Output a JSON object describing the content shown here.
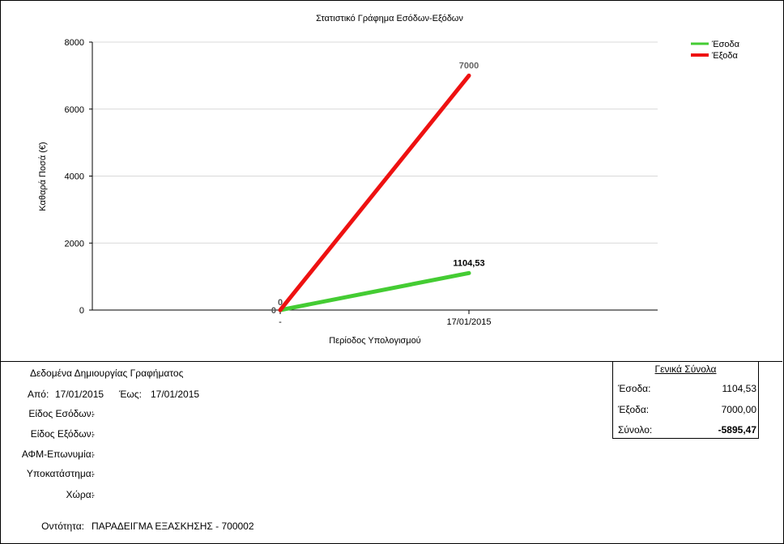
{
  "chart_data": {
    "type": "line",
    "title": "Στατιστικό Γράφημα Εσόδων-Εξόδων",
    "xlabel": "Περίοδος Υπολογισμού",
    "ylabel": "Καθαρά Ποσά (€)",
    "categories": [
      "-",
      "17/01/2015"
    ],
    "ylim": [
      0,
      8000
    ],
    "yticks": [
      "0",
      "2000",
      "4000",
      "6000",
      "8000"
    ],
    "grid": true,
    "legend_position": "top-right",
    "series": [
      {
        "name": "Έσοδα",
        "values": [
          0,
          1104.53
        ],
        "labels": [
          "0",
          "1104,53"
        ],
        "color": "#44cc33"
      },
      {
        "name": "Έξοδα",
        "values": [
          0,
          7000
        ],
        "labels": [
          "0",
          "7000"
        ],
        "color": "#ee1111"
      }
    ]
  },
  "params": {
    "section_title": "Δεδομένα Δημιουργίας Γραφήματος",
    "from_label": "Από:",
    "from_value": "17/01/2015",
    "to_label": "Έως:",
    "to_value": "17/01/2015",
    "income_type_label": "Είδος Εσόδων:",
    "income_type_value": "-",
    "expense_type_label": "Είδος Εξόδων:",
    "expense_type_value": "-",
    "afm_label": "ΑΦΜ-Επωνυμία:",
    "afm_value": "-",
    "branch_label": "Υποκατάστημα:",
    "branch_value": "-",
    "country_label": "Χώρα:",
    "country_value": "-",
    "entity_label": "Οντότητα:",
    "entity_value": "ΠΑΡΑΔΕΙΓΜΑ ΕΞΑΣΚΗΣΗΣ - 700002"
  },
  "totals": {
    "title": "Γενικά Σύνολα",
    "income_label": "Έσοδα:",
    "income_value": "1104,53",
    "expense_label": "Έξοδα:",
    "expense_value": "7000,00",
    "sum_label": "Σύνολο:",
    "sum_value": "-5895,47"
  }
}
